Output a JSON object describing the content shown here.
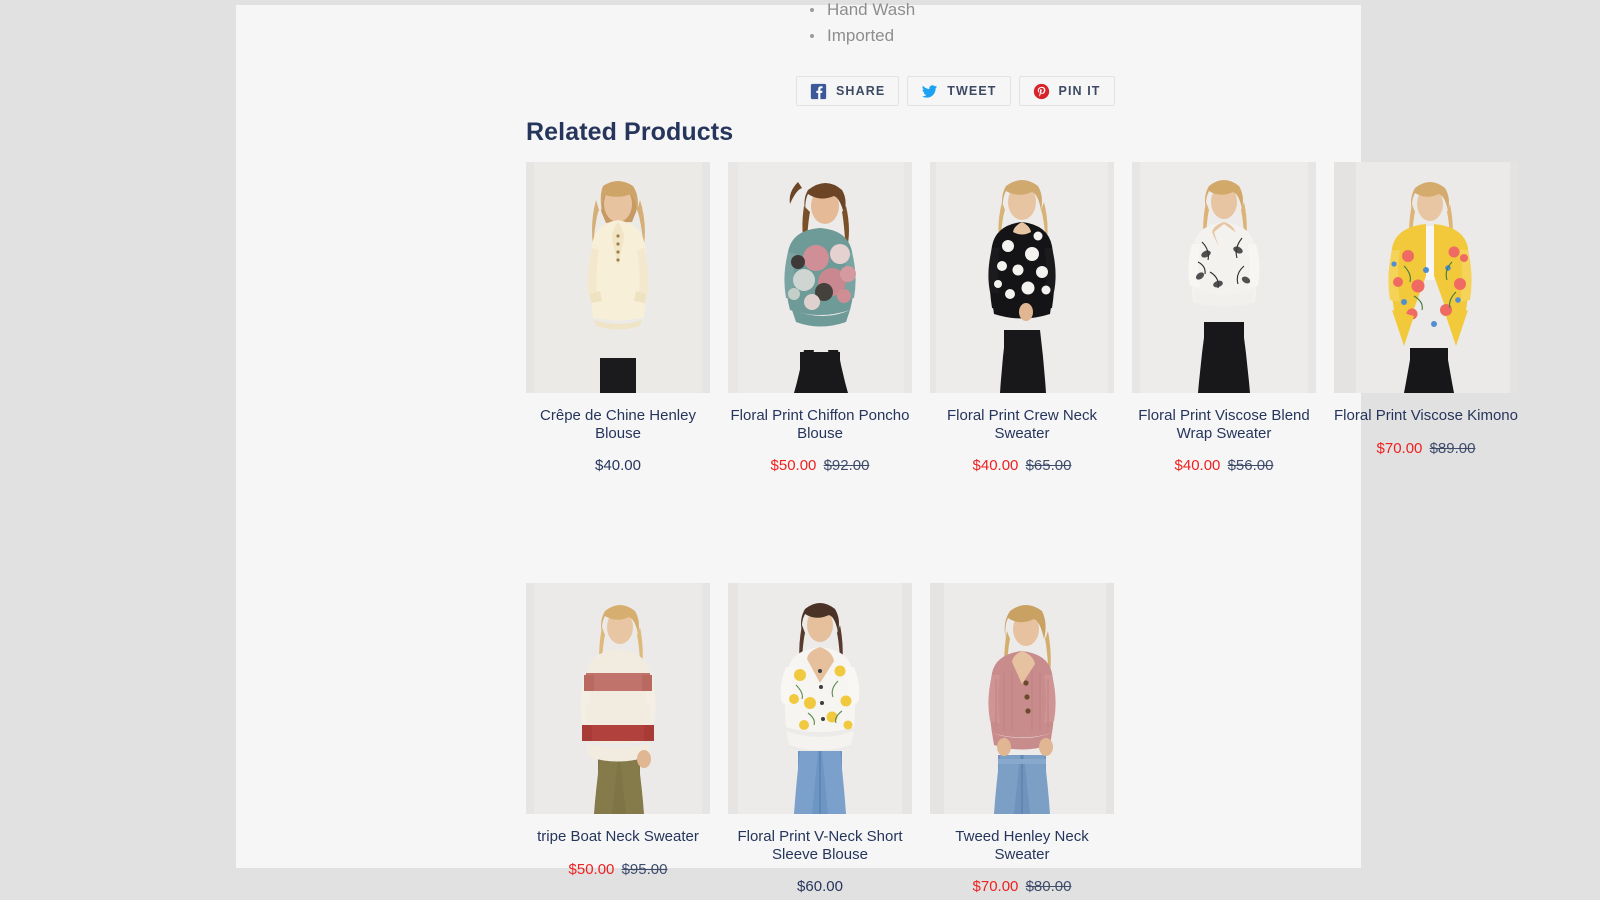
{
  "specs": {
    "items": [
      "Hand Wash",
      "Imported"
    ]
  },
  "social": {
    "buttons": [
      {
        "label": "SHARE",
        "icon": "facebook-icon",
        "color": "#3b5998"
      },
      {
        "label": "TWEET",
        "icon": "twitter-icon",
        "color": "#1da1f2"
      },
      {
        "label": "PIN IT",
        "icon": "pinterest-icon",
        "color": "#d9232a"
      }
    ]
  },
  "related": {
    "heading": "Related Products",
    "products": [
      {
        "title": "Crêpe de Chine Henley Blouse",
        "price": "$40.00",
        "compare_at": "",
        "on_sale": false
      },
      {
        "title": "Floral Print Chiffon Poncho Blouse",
        "price": "$50.00",
        "compare_at": "$92.00",
        "on_sale": true
      },
      {
        "title": "Floral Print Crew Neck Sweater",
        "price": "$40.00",
        "compare_at": "$65.00",
        "on_sale": true
      },
      {
        "title": "Floral Print Viscose Blend Wrap Sweater",
        "price": "$40.00",
        "compare_at": "$56.00",
        "on_sale": true
      },
      {
        "title": "Floral Print Viscose Kimono",
        "price": "$70.00",
        "compare_at": "$89.00",
        "on_sale": true
      },
      {
        "title": "tripe Boat Neck Sweater",
        "price": "$50.00",
        "compare_at": "$95.00",
        "on_sale": true
      },
      {
        "title": "Floral Print V-Neck Short Sleeve Blouse",
        "price": "$60.00",
        "compare_at": "",
        "on_sale": false
      },
      {
        "title": "Tweed Henley Neck Sweater",
        "price": "$70.00",
        "compare_at": "$80.00",
        "on_sale": true
      }
    ]
  },
  "colors": {
    "page_background": "#e1e1e1",
    "panel_background": "#f6f6f6",
    "heading_navy": "#26355c",
    "sale_red": "#f02020",
    "spec_gray": "#8e8e8e"
  }
}
